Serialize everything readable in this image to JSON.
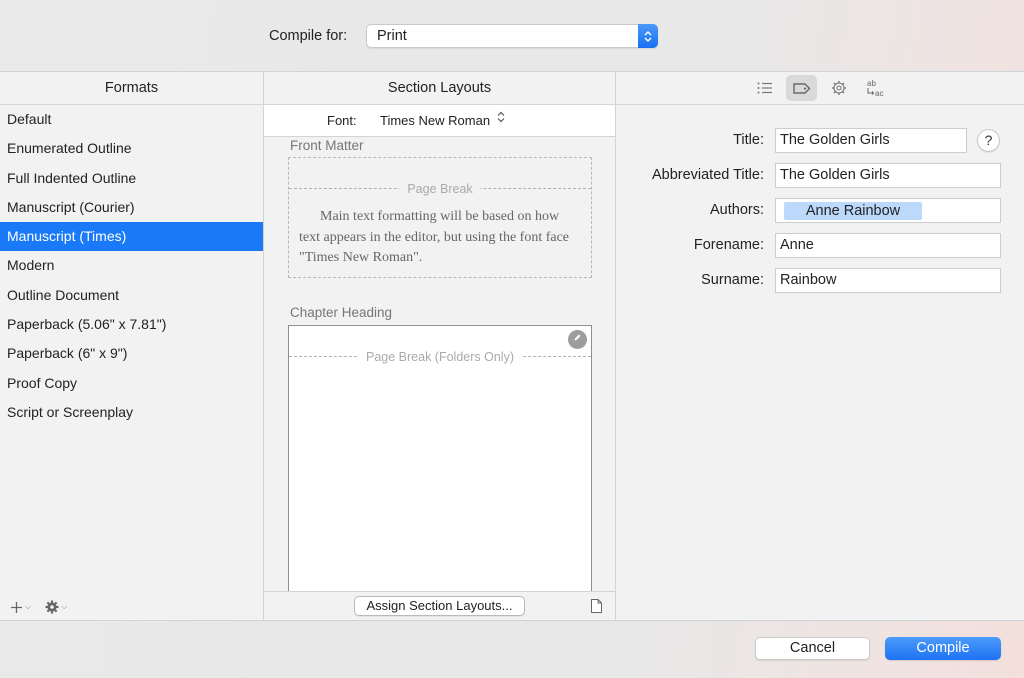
{
  "header": {
    "compile_for_label": "Compile for:",
    "compile_for_value": "Print"
  },
  "formats": {
    "title": "Formats",
    "items": [
      {
        "label": "Default",
        "selected": false
      },
      {
        "label": "Enumerated Outline",
        "selected": false
      },
      {
        "label": "Full Indented Outline",
        "selected": false
      },
      {
        "label": "Manuscript (Courier)",
        "selected": false
      },
      {
        "label": "Manuscript (Times)",
        "selected": true
      },
      {
        "label": "Modern",
        "selected": false
      },
      {
        "label": "Outline Document",
        "selected": false
      },
      {
        "label": "Paperback (5.06\" x 7.81\")",
        "selected": false
      },
      {
        "label": "Paperback (6\" x 9\")",
        "selected": false
      },
      {
        "label": "Proof Copy",
        "selected": false
      },
      {
        "label": "Script or Screenplay",
        "selected": false
      }
    ],
    "footer": {
      "add_icon": "plus-icon",
      "settings_icon": "gear-icon"
    }
  },
  "section_layouts": {
    "title": "Section Layouts",
    "font_label": "Font:",
    "font_value": "Times New Roman",
    "front_matter": {
      "label": "Front Matter",
      "page_break": "Page Break",
      "body": "Main text formatting will be based on how text appears in the editor, but using the font face \"Times New Roman\"."
    },
    "chapter_heading": {
      "label": "Chapter Heading",
      "page_break": "Page Break (Folders Only)"
    },
    "assign_button": "Assign Section Layouts..."
  },
  "metadata": {
    "toolbar": [
      {
        "icon": "list-icon",
        "active": false
      },
      {
        "icon": "tag-icon",
        "active": true
      },
      {
        "icon": "gear-icon",
        "active": false
      },
      {
        "icon": "replace-text-icon",
        "active": false
      }
    ],
    "fields": {
      "title": {
        "label": "Title:",
        "value": "The Golden Girls"
      },
      "abbreviated_title": {
        "label": "Abbreviated Title:",
        "value": "The Golden Girls"
      },
      "authors": {
        "label": "Authors:",
        "tokens": [
          "Anne Rainbow"
        ]
      },
      "forename": {
        "label": "Forename:",
        "value": "Anne"
      },
      "surname": {
        "label": "Surname:",
        "value": "Rainbow"
      }
    },
    "help_label": "?"
  },
  "actions": {
    "cancel": "Cancel",
    "compile": "Compile"
  },
  "colors": {
    "accent": "#1a79f7",
    "token": "#bcd8fb"
  }
}
